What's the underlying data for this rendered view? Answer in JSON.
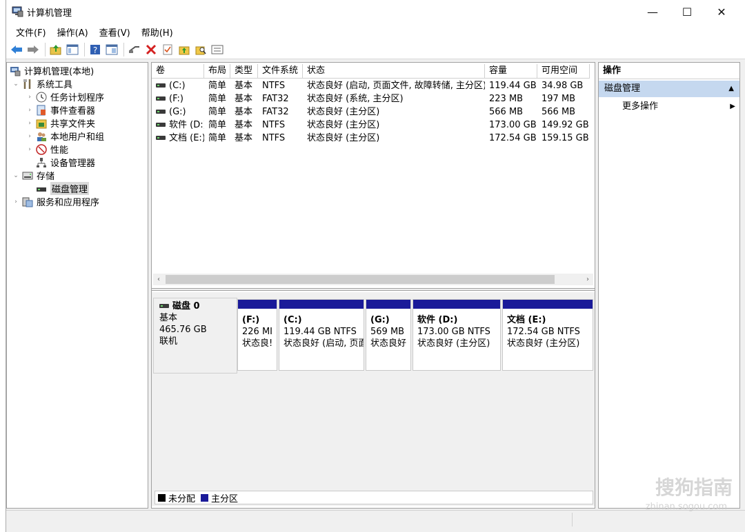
{
  "window": {
    "title": "计算机管理",
    "minimize": "—",
    "maximize": "☐",
    "close": "✕"
  },
  "menu": [
    "文件(F)",
    "操作(A)",
    "查看(V)",
    "帮助(H)"
  ],
  "toolbar_icons": [
    "back-icon",
    "forward-icon",
    "up-folder-icon",
    "show-hide-console-icon",
    "help-icon",
    "properties-icon",
    "connect-icon",
    "delete-icon",
    "check-icon",
    "folder-up-icon",
    "search-folder-icon",
    "list-icon"
  ],
  "tree": [
    {
      "label": "计算机管理(本地)",
      "icon": "computer-management-icon",
      "arrow": "",
      "level": 0
    },
    {
      "label": "系统工具",
      "icon": "tools-icon",
      "arrow": "⌄",
      "level": 1
    },
    {
      "label": "任务计划程序",
      "icon": "clock-icon",
      "arrow": "›",
      "level": 2
    },
    {
      "label": "事件查看器",
      "icon": "event-viewer-icon",
      "arrow": "›",
      "level": 2
    },
    {
      "label": "共享文件夹",
      "icon": "shared-folder-icon",
      "arrow": "›",
      "level": 2
    },
    {
      "label": "本地用户和组",
      "icon": "users-icon",
      "arrow": "›",
      "level": 2
    },
    {
      "label": "性能",
      "icon": "performance-icon",
      "arrow": "›",
      "level": 2
    },
    {
      "label": "设备管理器",
      "icon": "device-manager-icon",
      "arrow": "",
      "level": 2
    },
    {
      "label": "存储",
      "icon": "storage-icon",
      "arrow": "⌄",
      "level": 1
    },
    {
      "label": "磁盘管理",
      "icon": "disk-management-icon",
      "arrow": "",
      "level": 2,
      "selected": true
    },
    {
      "label": "服务和应用程序",
      "icon": "services-icon",
      "arrow": "›",
      "level": 1
    }
  ],
  "volume_list": {
    "headers": [
      "卷",
      "布局",
      "类型",
      "文件系统",
      "状态",
      "容量",
      "可用空间"
    ],
    "rows": [
      [
        "(C:)",
        "简单",
        "基本",
        "NTFS",
        "状态良好 (启动, 页面文件, 故障转储, 主分区)",
        "119.44 GB",
        "34.98 GB"
      ],
      [
        "(F:)",
        "简单",
        "基本",
        "FAT32",
        "状态良好 (系统, 主分区)",
        "223 MB",
        "197 MB"
      ],
      [
        "(G:)",
        "简单",
        "基本",
        "FAT32",
        "状态良好 (主分区)",
        "566 MB",
        "566 MB"
      ],
      [
        "软件 (D:)",
        "简单",
        "基本",
        "NTFS",
        "状态良好 (主分区)",
        "173.00 GB",
        "149.92 GB"
      ],
      [
        "文档 (E:)",
        "简单",
        "基本",
        "NTFS",
        "状态良好 (主分区)",
        "172.54 GB",
        "159.15 GB"
      ]
    ]
  },
  "scroll": {
    "left": "‹",
    "right": "›"
  },
  "disk": {
    "name": "磁盘 0",
    "type": "基本",
    "size": "465.76 GB",
    "status": "联机",
    "partitions": [
      {
        "label": "(F:)",
        "size": "226 MI",
        "status": "状态良!"
      },
      {
        "label": "(C:)",
        "size": "119.44 GB NTFS",
        "status": "状态良好 (启动, 页面"
      },
      {
        "label": "(G:)",
        "size": "569 MB",
        "status": "状态良好"
      },
      {
        "label": "软件  (D:)",
        "size": "173.00 GB NTFS",
        "status": "状态良好 (主分区)"
      },
      {
        "label": "文档  (E:)",
        "size": "172.54 GB NTFS",
        "status": "状态良好 (主分区)"
      }
    ]
  },
  "legend": [
    {
      "label": "未分配",
      "color": "#000000"
    },
    {
      "label": "主分区",
      "color": "#1a1a99"
    }
  ],
  "actions": {
    "header": "操作",
    "section": "磁盘管理",
    "section_arrow": "▲",
    "item": "更多操作",
    "item_arrow": "▶"
  },
  "watermark": {
    "text": "搜狗指南",
    "url": "zhinan.sogou.com"
  }
}
